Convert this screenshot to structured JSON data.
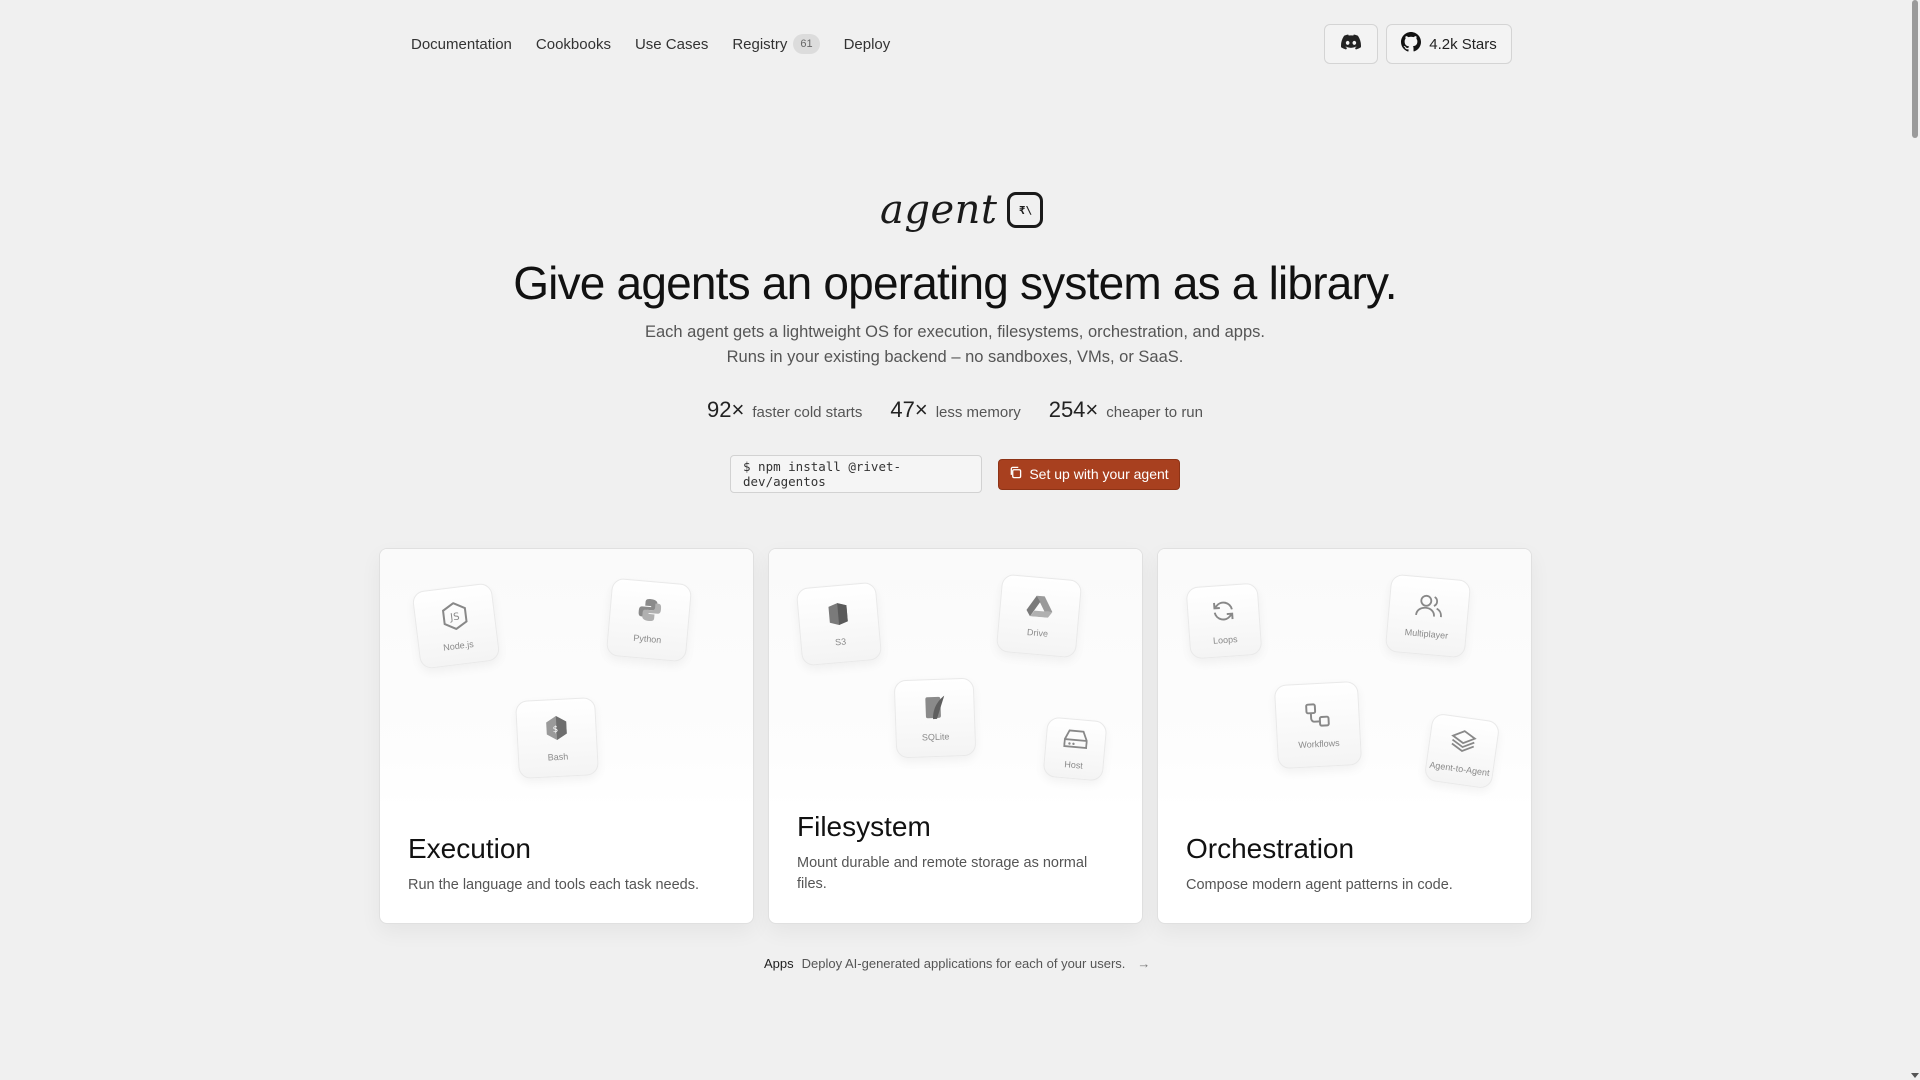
{
  "nav": {
    "links": [
      "Documentation",
      "Cookbooks",
      "Use Cases",
      "Registry",
      "Deploy"
    ],
    "registry_badge": "61",
    "github_label": "4.2k Stars"
  },
  "hero": {
    "logo_word": "agent",
    "logo_mark": "₹\\",
    "headline": "Give agents an operating system as a library.",
    "subline_1": "Each agent gets a lightweight OS for execution, filesystems, orchestration, and apps.",
    "subline_2": "Runs in your existing backend – no sandboxes, VMs, or SaaS.",
    "stats": [
      {
        "value": "92×",
        "label": "faster cold starts"
      },
      {
        "value": "47×",
        "label": "less memory"
      },
      {
        "value": "254×",
        "label": "cheaper to run"
      }
    ],
    "install_command": "$ npm install @rivet-dev/agentos",
    "cta_label": "Set up with your agent"
  },
  "cards": [
    {
      "title": "Execution",
      "description": "Run the language and tools each task needs.",
      "tiles": [
        "Node.js",
        "Python",
        "Bash"
      ]
    },
    {
      "title": "Filesystem",
      "description": "Mount durable and remote storage as normal files.",
      "tiles": [
        "S3",
        "Drive",
        "SQLite",
        "Host"
      ]
    },
    {
      "title": "Orchestration",
      "description": "Compose modern agent patterns in code.",
      "tiles": [
        "Loops",
        "Multiplayer",
        "Workflows",
        "Agent-to-Agent"
      ]
    }
  ],
  "apps": {
    "label": "Apps",
    "description": "Deploy AI-generated applications for each of your users.",
    "arrow": "→"
  },
  "colors": {
    "background": "#f0f0f0",
    "accent": "#a8401f"
  }
}
